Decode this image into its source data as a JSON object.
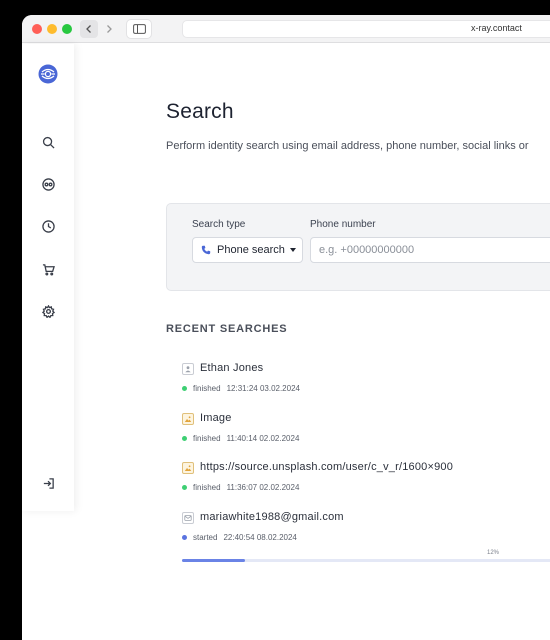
{
  "browser": {
    "url": "x-ray.contact"
  },
  "sidebar": {
    "items": [
      {
        "icon": "logo-icon"
      },
      {
        "icon": "search-icon"
      },
      {
        "icon": "mask-icon"
      },
      {
        "icon": "history-icon"
      },
      {
        "icon": "cart-icon"
      },
      {
        "icon": "gear-icon"
      },
      {
        "icon": "logout-icon"
      }
    ]
  },
  "page": {
    "title": "Search",
    "subtitle": "Perform identity search using email address, phone number, social links or"
  },
  "search": {
    "type_label": "Search type",
    "type_value": "Phone search",
    "phone_label": "Phone number",
    "phone_placeholder": "e.g. +00000000000"
  },
  "recent": {
    "heading": "RECENT SEARCHES",
    "items": [
      {
        "name": "Ethan Jones",
        "kind": "person-icon",
        "status": "finished",
        "time": "12:31:24 03.02.2024"
      },
      {
        "name": "Image",
        "kind": "image-icon",
        "status": "finished",
        "time": "11:40:14 02.02.2024"
      },
      {
        "name": "https://source.unsplash.com/user/c_v_r/1600×900",
        "kind": "image-icon",
        "status": "finished",
        "time": "11:36:07 02.02.2024"
      },
      {
        "name": "mariawhite1988@gmail.com",
        "kind": "email-icon",
        "status": "started",
        "time": "22:40:54 08.02.2024"
      }
    ],
    "progress": {
      "label": "12%",
      "value": 0.15
    }
  },
  "colors": {
    "accent": "#6a83e6",
    "finished": "#3ecf73",
    "started": "#5b74e0",
    "logo": "#4a67d6"
  }
}
